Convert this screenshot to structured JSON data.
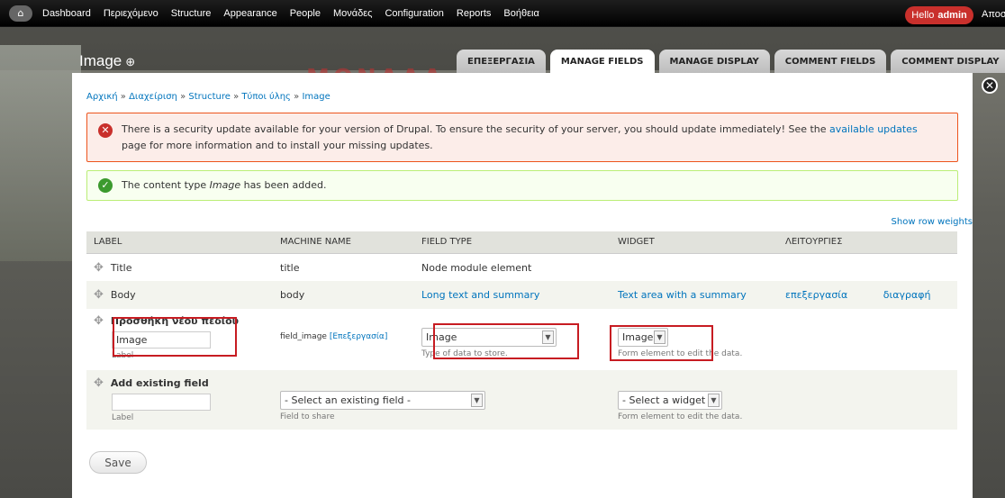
{
  "toolbar": {
    "items": [
      "Dashboard",
      "Περιεχόμενο",
      "Structure",
      "Appearance",
      "People",
      "Μονάδες",
      "Configuration",
      "Reports",
      "Βοήθεια"
    ],
    "hello_prefix": "Hello",
    "hello_user": "admin",
    "logout": "Αποσ"
  },
  "background": {
    "title": "ΜΟΝΑΔΑ ΠΡ"
  },
  "overlay": {
    "title": "Image",
    "plus": "⊕",
    "tabs": [
      "ΕΠΕΞΕΡΓΑΣΙΑ",
      "MANAGE FIELDS",
      "MANAGE DISPLAY",
      "COMMENT FIELDS",
      "COMMENT DISPLAY"
    ],
    "active_tab": "MANAGE FIELDS"
  },
  "breadcrumb": {
    "items": [
      "Αρχική",
      "Διαχείριση",
      "Structure",
      "Τύποι ύλης",
      "Image"
    ],
    "separator": "»"
  },
  "messages": {
    "error_pre": "There is a security update available for your version of Drupal. To ensure the security of your server, you should update immediately! See the",
    "error_link": "available updates",
    "error_post": "page for more information and to install your missing updates.",
    "ok_pre": "The content type",
    "ok_em": "Image",
    "ok_post": "has been added."
  },
  "show_row_weights": "Show row weights",
  "table": {
    "headers": [
      "LABEL",
      "MACHINE NAME",
      "FIELD TYPE",
      "WIDGET",
      "ΛΕΙΤΟΥΡΓΙΕΣ"
    ],
    "title_row": {
      "label": "Title",
      "machine": "title",
      "type": "Node module element"
    },
    "body_row": {
      "label": "Body",
      "machine": "body",
      "type": "Long text and summary",
      "widget": "Text area with a summary",
      "edit": "επεξεργασία",
      "delete": "διαγραφή"
    },
    "new_field": {
      "heading": "Προσθήκη νέου πεδίου",
      "label_value": "Image",
      "label_desc": "Label",
      "machine": "field_image",
      "machine_edit": "[Επεξεργασία]",
      "type_value": "Image",
      "type_desc": "Type of data to store.",
      "widget_value": "Image",
      "widget_desc": "Form element to edit the data."
    },
    "existing_field": {
      "heading": "Add existing field",
      "label_value": "",
      "label_desc": "Label",
      "field_value": "- Select an existing field -",
      "field_desc": "Field to share",
      "widget_value": "- Select a widget -",
      "widget_desc": "Form element to edit the data."
    }
  },
  "save_label": "Save",
  "colors": {
    "highlight": "#c71c22",
    "link": "#0074bd",
    "error_border": "#ed541d"
  }
}
